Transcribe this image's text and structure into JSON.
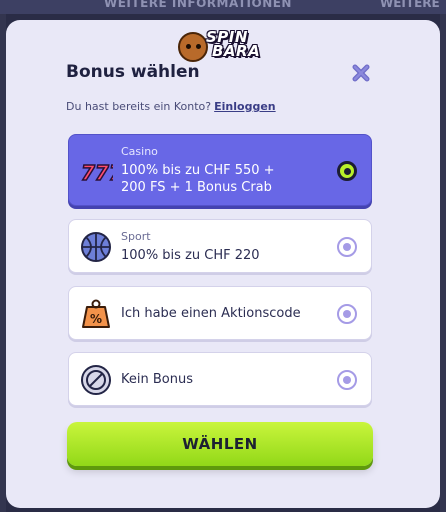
{
  "background": {
    "banner_text": "WEITERE INFORMATIONEN",
    "banner_text_right": "WEITERE"
  },
  "brand": {
    "logo_line1": "SPIN",
    "logo_line2": "BARA"
  },
  "dialog": {
    "title": "Bonus wählen",
    "account_prompt": "Du hast bereits ein Konto?",
    "login_link": "Einloggen",
    "submit_label": "WÄHLEN"
  },
  "options": [
    {
      "category": "Casino",
      "line1": "100% bis zu CHF 550 +",
      "line2": "200 FS + 1 Bonus Crab",
      "icon": "slot-777-icon",
      "selected": true
    },
    {
      "category": "Sport",
      "line1": "100% bis zu CHF 220",
      "icon": "basketball-icon",
      "selected": false
    },
    {
      "category": "",
      "line1": "Ich habe einen Aktionscode",
      "icon": "promo-tag-icon",
      "selected": false
    },
    {
      "category": "",
      "line1": "Kein Bonus",
      "icon": "no-bonus-icon",
      "selected": false
    }
  ],
  "colors": {
    "accent": "#6867e6",
    "cta": "#b8f02a",
    "radio": "#a59be6"
  }
}
